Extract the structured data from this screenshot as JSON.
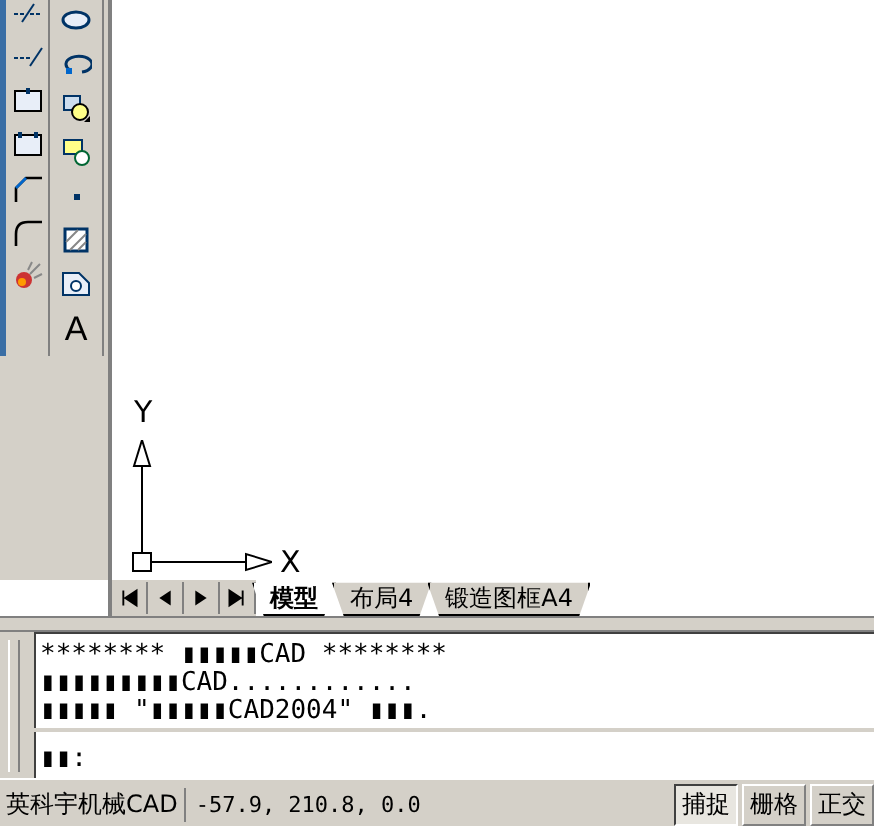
{
  "toolbar": {
    "text_tool": "A"
  },
  "drawing": {
    "axis_x": "X",
    "axis_y": "Y"
  },
  "layout_tabs": [
    {
      "label": "模型",
      "selected": true
    },
    {
      "label": "布局4",
      "selected": false
    },
    {
      "label": "锻造图框A4",
      "selected": false
    }
  ],
  "command_window": {
    "lines": [
      "******** ▮▮▮▮▮CAD ********",
      "▮▮▮▮▮▮▮▮▮CAD............",
      "▮▮▮▮▮ \"▮▮▮▮▮CAD2004\" ▮▮▮."
    ],
    "prompt": "▮▮:"
  },
  "status_bar": {
    "app": "英科宇机械CAD",
    "coordinates": "-57.9, 210.8, 0.0",
    "toggles": [
      {
        "label": "捕捉",
        "on": true
      },
      {
        "label": "栅格",
        "on": false
      },
      {
        "label": "正交",
        "on": false
      }
    ]
  }
}
